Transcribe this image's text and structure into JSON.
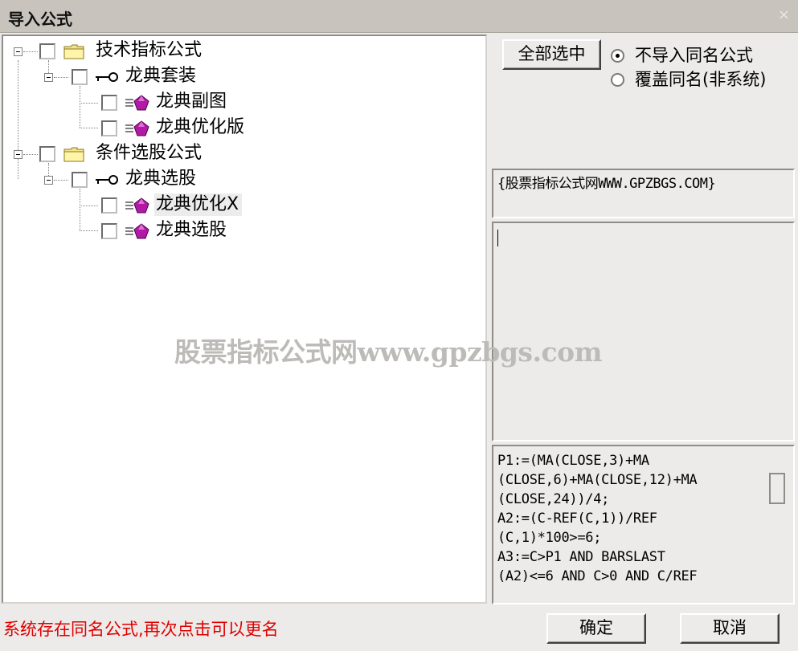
{
  "window": {
    "title": "导入公式",
    "close": "×"
  },
  "tree": {
    "nodes": [
      {
        "label": "技术指标公式",
        "icon": "folder-icon"
      },
      {
        "label": "龙典套装",
        "icon": "key-icon"
      },
      {
        "label": "龙典副图",
        "icon": "formula-gem-icon"
      },
      {
        "label": "龙典优化版",
        "icon": "formula-gem-icon"
      },
      {
        "label": "条件选股公式",
        "icon": "folder-icon"
      },
      {
        "label": "龙典选股",
        "icon": "key-icon"
      },
      {
        "label": "龙典优化X",
        "icon": "formula-gem-icon",
        "highlighted": true
      },
      {
        "label": "龙典选股",
        "icon": "formula-gem-icon"
      }
    ]
  },
  "options": {
    "select_all_label": "全部选中",
    "radio_no_import": "不导入同名公式",
    "radio_overwrite": "覆盖同名(非系统)",
    "selected": "radio_no_import"
  },
  "source_text": "{股票指标公式网WWW.GPZBGS.COM}",
  "code_text": "P1:=(MA(CLOSE,3)+MA\n(CLOSE,6)+MA(CLOSE,12)+MA\n(CLOSE,24))/4;\nA2:=(C-REF(C,1))/REF\n(C,1)*100>=6;\nA3:=C>P1 AND BARSLAST\n(A2)<=6 AND C>0 AND C/REF",
  "watermark": "股票指标公式网www.gpzbgs.com",
  "status_message": "系统存在同名公式,再次点击可以更名",
  "buttons": {
    "ok": "确定",
    "cancel": "取消"
  }
}
